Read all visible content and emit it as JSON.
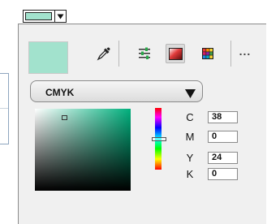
{
  "colors": {
    "current": "#a2e2cd",
    "gradient_hue": "#00b07d"
  },
  "swatch_button": {
    "icon": "chevron-down-icon"
  },
  "toolbar": {
    "tools": [
      {
        "name": "eyedropper-icon"
      },
      {
        "name": "sliders-icon"
      },
      {
        "name": "gradient-square-icon",
        "selected": true
      },
      {
        "name": "palette-grid-icon"
      }
    ],
    "more_label": "..."
  },
  "mode": {
    "selected": "CMYK"
  },
  "channels": [
    {
      "label": "C",
      "value": "38"
    },
    {
      "label": "M",
      "value": "0"
    },
    {
      "label": "Y",
      "value": "24"
    },
    {
      "label": "K",
      "value": "0"
    }
  ]
}
